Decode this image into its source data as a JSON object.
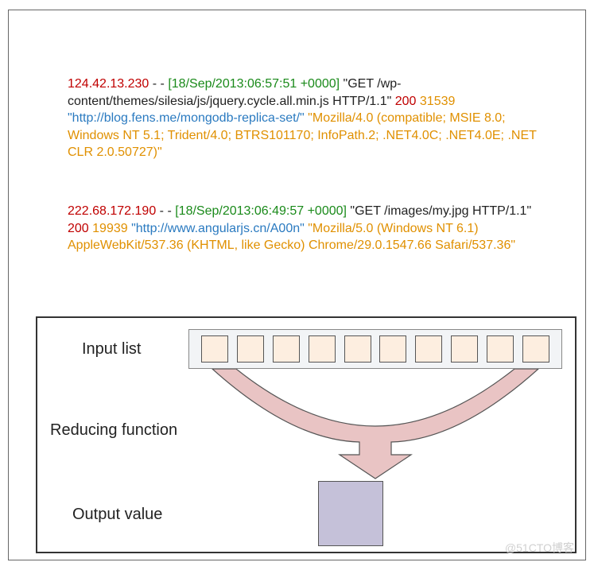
{
  "logs": [
    {
      "ip": "124.42.13.230",
      "dashes": " - - ",
      "timestamp": "[18/Sep/2013:06:57:51 +0000]",
      "request": " \"GET /wp-content/themes/silesia/js/jquery.cycle.all.min.js HTTP/1.1\" ",
      "status": "200",
      "bytes": " 31539 ",
      "referer": "\"http://blog.fens.me/mongodb-replica-set/\"",
      "ua": " \"Mozilla/4.0 (compatible; MSIE 8.0; Windows NT 5.1; Trident/4.0; BTRS101170; InfoPath.2; .NET4.0C; .NET4.0E; .NET CLR 2.0.50727)\""
    },
    {
      "ip": "222.68.172.190",
      "dashes": " - - ",
      "timestamp": "[18/Sep/2013:06:49:57 +0000]",
      "request": " \"GET /images/my.jpg HTTP/1.1\" ",
      "status": "200",
      "bytes": " 19939 ",
      "referer": "\"http://www.angularjs.cn/A00n\"",
      "ua": " \"Mozilla/5.0 (Windows NT 6.1) AppleWebKit/537.36 (KHTML, like Gecko) Chrome/29.0.1547.66 Safari/537.36\""
    }
  ],
  "diagram": {
    "input_label": "Input list",
    "function_label": "Reducing function",
    "output_label": "Output value",
    "input_count": 10
  },
  "watermark": "@51CTO博客",
  "colors": {
    "input_fill": "#fdeee0",
    "output_fill": "#c5c1d9",
    "funnel_fill": "#e9c4c4"
  }
}
